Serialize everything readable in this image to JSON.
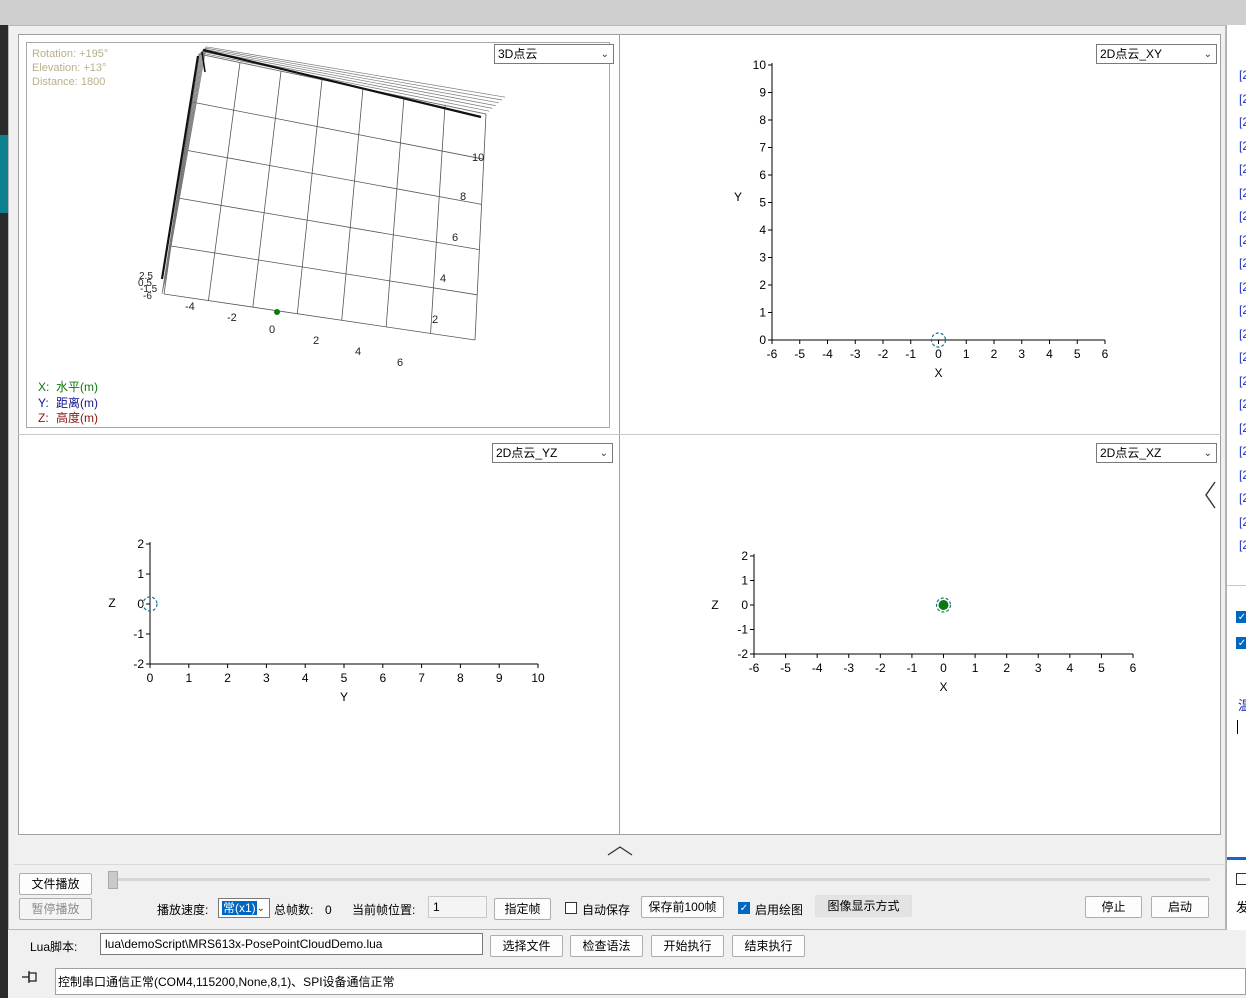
{
  "view3d": {
    "rotation": "Rotation:  +195°",
    "elevation": "Elevation: +13°",
    "distance": "Distance:  1800",
    "dropdown": "3D点云",
    "x_ticks": [
      "-4",
      "-2",
      "0",
      "2",
      "4",
      "6"
    ],
    "y_ticks": [
      "2",
      "4",
      "6",
      "8",
      "10"
    ],
    "z_ticks": [
      "2.5",
      "0.5",
      "-1.5",
      "-6"
    ],
    "legend": [
      {
        "key": "X:",
        "text": "水平(m)",
        "color": "#0a7a0a"
      },
      {
        "key": "Y:",
        "text": "距离(m)",
        "color": "#14148c"
      },
      {
        "key": "Z:",
        "text": "高度(m)",
        "color": "#8c1414"
      }
    ],
    "text_color": "#b8b08a",
    "point": {
      "x": 0,
      "y": 0,
      "z": 0
    }
  },
  "chart_data": [
    {
      "type": "scatter",
      "name_shown": "2D点云_XY",
      "xlabel": "X",
      "ylabel": "Y",
      "xlim": [
        -6,
        6
      ],
      "ylim": [
        0,
        10
      ],
      "xticks": [
        "-6",
        "-5",
        "-4",
        "-3",
        "-2",
        "-1",
        "0",
        "1",
        "2",
        "3",
        "4",
        "5",
        "6"
      ],
      "yticks": [
        "0",
        "1",
        "2",
        "3",
        "4",
        "5",
        "6",
        "7",
        "8",
        "9",
        "10"
      ],
      "points": [
        {
          "x": 0,
          "y": 0
        }
      ],
      "marker": "hollow-dashed-circle"
    },
    {
      "type": "scatter",
      "name_shown": "2D点云_YZ",
      "xlabel": "Y",
      "ylabel": "Z",
      "xlim": [
        0,
        10
      ],
      "ylim": [
        -2,
        2
      ],
      "xticks": [
        "0",
        "1",
        "2",
        "3",
        "4",
        "5",
        "6",
        "7",
        "8",
        "9",
        "10"
      ],
      "yticks": [
        "-2",
        "-1",
        "0",
        "1",
        "2"
      ],
      "points": [
        {
          "x": 0,
          "y": 0
        }
      ],
      "marker": "hollow-dashed-circle"
    },
    {
      "type": "scatter",
      "name_shown": "2D点云_XZ",
      "xlabel": "X",
      "ylabel": "Z",
      "xlim": [
        -6,
        6
      ],
      "ylim": [
        -2,
        2
      ],
      "xticks": [
        "-6",
        "-5",
        "-4",
        "-3",
        "-2",
        "-1",
        "0",
        "1",
        "2",
        "3",
        "4",
        "5",
        "6"
      ],
      "yticks": [
        "-2",
        "-1",
        "0",
        "1",
        "2"
      ],
      "points": [
        {
          "x": 0,
          "y": 0
        }
      ],
      "marker": "filled-green-dashed-circle"
    }
  ],
  "dropdowns": {
    "xy": "2D点云_XY",
    "yz": "2D点云_YZ",
    "xz": "2D点云_XZ"
  },
  "playback": {
    "file_play": "文件播放",
    "pause_play": "暂停播放",
    "speed_label": "播放速度:",
    "speed_value": "常(x1)",
    "total_frames_label": "总帧数:",
    "total_frames_value": "0",
    "current_frame_label": "当前帧位置:",
    "current_frame_value": "1",
    "goto_frame": "指定帧",
    "auto_save": "自动保存",
    "save_first_100": "保存前100帧",
    "enable_plot": "启用绘图",
    "image_display_mode": "图像显示方式",
    "stop": "停止",
    "start": "启动",
    "auto_save_checked": false,
    "enable_plot_checked": true
  },
  "lua": {
    "label": "Lua脚本:",
    "path": "lua\\demoScript\\MRS613x-PosePointCloudDemo.lua",
    "select_file": "选择文件",
    "check_syntax": "检查语法",
    "start_exec": "开始执行",
    "end_exec": "结束执行"
  },
  "status": {
    "text": "控制串口通信正常(COM4,115200,None,8,1)、SPI设备通信正常",
    "pin_icon": "pin-icon"
  },
  "right_panel": {
    "items": [
      "[2",
      "[2",
      "[2",
      "[2",
      "[2",
      "[2",
      "[2",
      "[2",
      "[2",
      "[2",
      "[2",
      "[2",
      "[2",
      "[2",
      "[2",
      "[2",
      "[2",
      "[2",
      "[2",
      "[2",
      "[2"
    ],
    "truncated_link": "温",
    "truncated_text": "发"
  },
  "colors": {
    "accent": "#0e7f8e",
    "point_green": "#0a7a0a",
    "marker_teal": "#1f6f8b"
  }
}
